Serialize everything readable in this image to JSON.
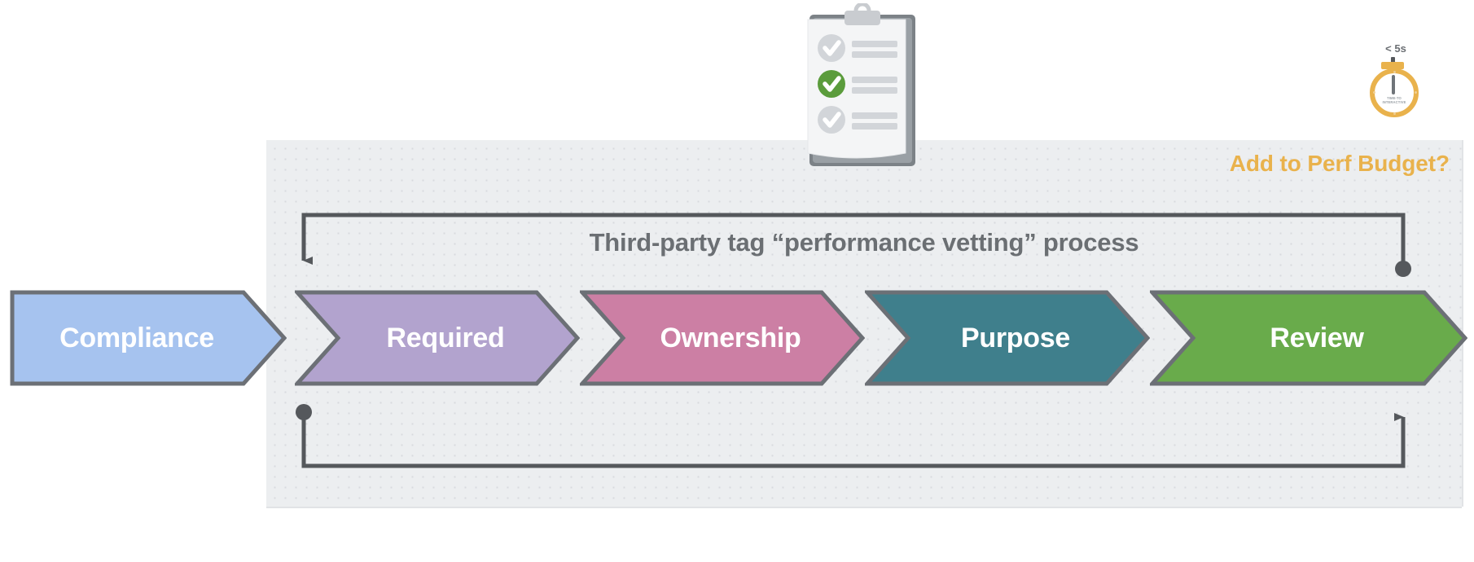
{
  "diagram": {
    "title": "Third-party tag “performance vetting” process",
    "budget_label": "Add to Perf Budget?",
    "panel_color": "#eceef0",
    "connector_color": "#55585c"
  },
  "stages": [
    {
      "label": "Compliance",
      "color": "#a6c3ef",
      "border": "#6c7076"
    },
    {
      "label": "Required",
      "color": "#b2a3ce",
      "border": "#6c7076"
    },
    {
      "label": "Ownership",
      "color": "#cc7fa4",
      "border": "#6c7076"
    },
    {
      "label": "Purpose",
      "color": "#3f7f8c",
      "border": "#6c7076"
    },
    {
      "label": "Review",
      "color": "#69ab4b",
      "border": "#6c7076"
    }
  ],
  "clipboard": {
    "icon": "clipboard-checklist-icon",
    "items": [
      {
        "state": "unchecked",
        "check_color": "#cfd2d6"
      },
      {
        "state": "checked",
        "check_color": "#5b9c3c"
      },
      {
        "state": "unchecked",
        "check_color": "#cfd2d6"
      }
    ],
    "board_color": "#7c8287",
    "paper_color": "#f4f5f6"
  },
  "stopwatch": {
    "icon": "stopwatch-icon",
    "threshold": "< 5s",
    "caption_line1": "TIME-TO",
    "caption_line2": "INTERACTIVE",
    "accent_color": "#e9b24c"
  },
  "connectors": [
    {
      "name": "top-feedback-loop",
      "start_cap": "dot",
      "end_cap": "arrow",
      "direction": "right-to-left"
    },
    {
      "name": "bottom-feedback-loop",
      "start_cap": "dot",
      "end_cap": "arrow",
      "direction": "left-to-right"
    }
  ]
}
